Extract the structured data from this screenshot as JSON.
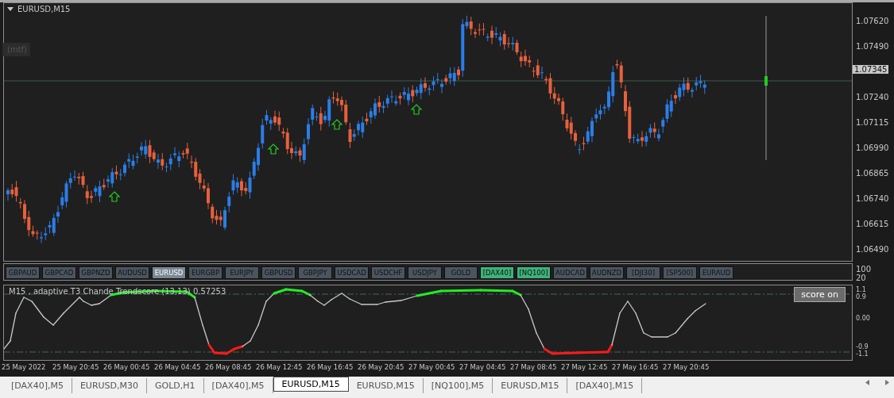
{
  "chart": {
    "title": "EURUSD,M15",
    "mtf_button": "(mtf)",
    "price_ticks": [
      {
        "label": "1.07620",
        "kind": "tick"
      },
      {
        "label": "1.07490",
        "kind": "tick"
      },
      {
        "label": "1.07345",
        "kind": "current"
      },
      {
        "label": "1.07240",
        "kind": "tick"
      },
      {
        "label": "1.07115",
        "kind": "tick"
      },
      {
        "label": "1.06990",
        "kind": "tick"
      },
      {
        "label": "1.06865",
        "kind": "tick"
      },
      {
        "label": "1.06740",
        "kind": "tick"
      },
      {
        "label": "1.06615",
        "kind": "tick"
      },
      {
        "label": "1.06490",
        "kind": "tick"
      }
    ]
  },
  "symbol_buttons": [
    {
      "label": "GBPAUD",
      "selected": false,
      "highlighted": false
    },
    {
      "label": "GBPCAD",
      "selected": false,
      "highlighted": false
    },
    {
      "label": "GBPNZD",
      "selected": false,
      "highlighted": false
    },
    {
      "label": "AUDUSD",
      "selected": false,
      "highlighted": false
    },
    {
      "label": "EURUSD",
      "selected": true,
      "highlighted": false
    },
    {
      "label": "EURGBP",
      "selected": false,
      "highlighted": false
    },
    {
      "label": "EURJPY",
      "selected": false,
      "highlighted": false
    },
    {
      "label": "GBPUSD",
      "selected": false,
      "highlighted": false
    },
    {
      "label": "GBPJPY",
      "selected": false,
      "highlighted": false
    },
    {
      "label": "USDCAD",
      "selected": false,
      "highlighted": false
    },
    {
      "label": "USDCHF",
      "selected": false,
      "highlighted": false
    },
    {
      "label": "USDJPY",
      "selected": false,
      "highlighted": false
    },
    {
      "label": "GOLD",
      "selected": false,
      "highlighted": false
    },
    {
      "label": "[DAX40]",
      "selected": false,
      "highlighted": true
    },
    {
      "label": "[NQ100]",
      "selected": false,
      "highlighted": true
    },
    {
      "label": "AUDCAD",
      "selected": false,
      "highlighted": false
    },
    {
      "label": "AUDNZD",
      "selected": false,
      "highlighted": false
    },
    {
      "label": "[DJI30]",
      "selected": false,
      "highlighted": false
    },
    {
      "label": "[SP500]",
      "selected": false,
      "highlighted": false
    },
    {
      "label": "EURAUD",
      "selected": false,
      "highlighted": false
    }
  ],
  "button_axis": [
    "100",
    "20"
  ],
  "indicator": {
    "title": "M15 , adaptive T3 Chande Trendscore (13,13) 0.57253",
    "score_button": "score on",
    "axis_groups": [
      {
        "labels": [
          "1.1",
          "0.9"
        ]
      },
      {
        "labels": [
          "0.00"
        ]
      },
      {
        "labels": [
          "-0.9",
          "-1.1"
        ]
      }
    ]
  },
  "time_axis": [
    "25 May 2022",
    "25 May 20:45",
    "26 May 00:45",
    "26 May 04:45",
    "26 May 08:45",
    "26 May 12:45",
    "26 May 16:45",
    "26 May 20:45",
    "27 May 00:45",
    "27 May 04:45",
    "27 May 08:45",
    "27 May 12:45",
    "27 May 16:45",
    "27 May 20:45"
  ],
  "tabs": [
    {
      "label": "[DAX40],M5",
      "selected": false
    },
    {
      "label": "EURUSD,M30",
      "selected": false
    },
    {
      "label": "GOLD,H1",
      "selected": false
    },
    {
      "label": "[DAX40],M5",
      "selected": false
    },
    {
      "label": "EURUSD,M15",
      "selected": true
    },
    {
      "label": "EURUSD,M15",
      "selected": false
    },
    {
      "label": "[NQ100],M5",
      "selected": false
    },
    {
      "label": "EURUSD,M15",
      "selected": false
    },
    {
      "label": "[DAX40],M15",
      "selected": false
    }
  ]
}
